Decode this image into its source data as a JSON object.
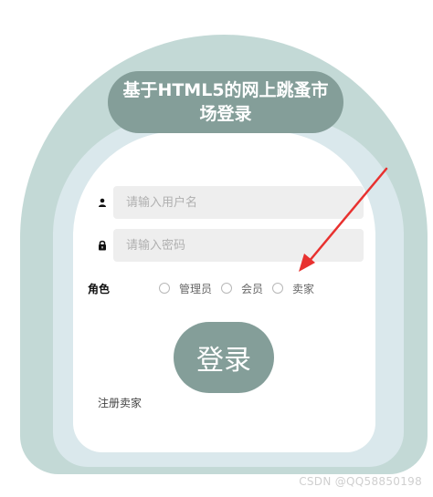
{
  "title": "基于HTML5的网上跳蚤市场登录",
  "form": {
    "username_placeholder": "请输入用户名",
    "password_placeholder": "请输入密码",
    "role_label": "角色",
    "roles": [
      "管理员",
      "会员",
      "卖家"
    ],
    "login_button": "登录",
    "register_link": "注册卖家"
  },
  "icons": {
    "username": "user-icon",
    "password": "lock-icon",
    "annotation": "red-arrow-icon"
  },
  "colors": {
    "outer_shell": "#c3d9d6",
    "middle_shell": "#dae8ec",
    "accent": "#849e99",
    "input_bg": "#eeeeee",
    "annotation_arrow": "#e8312f"
  },
  "watermark": "CSDN @QQ58850198"
}
